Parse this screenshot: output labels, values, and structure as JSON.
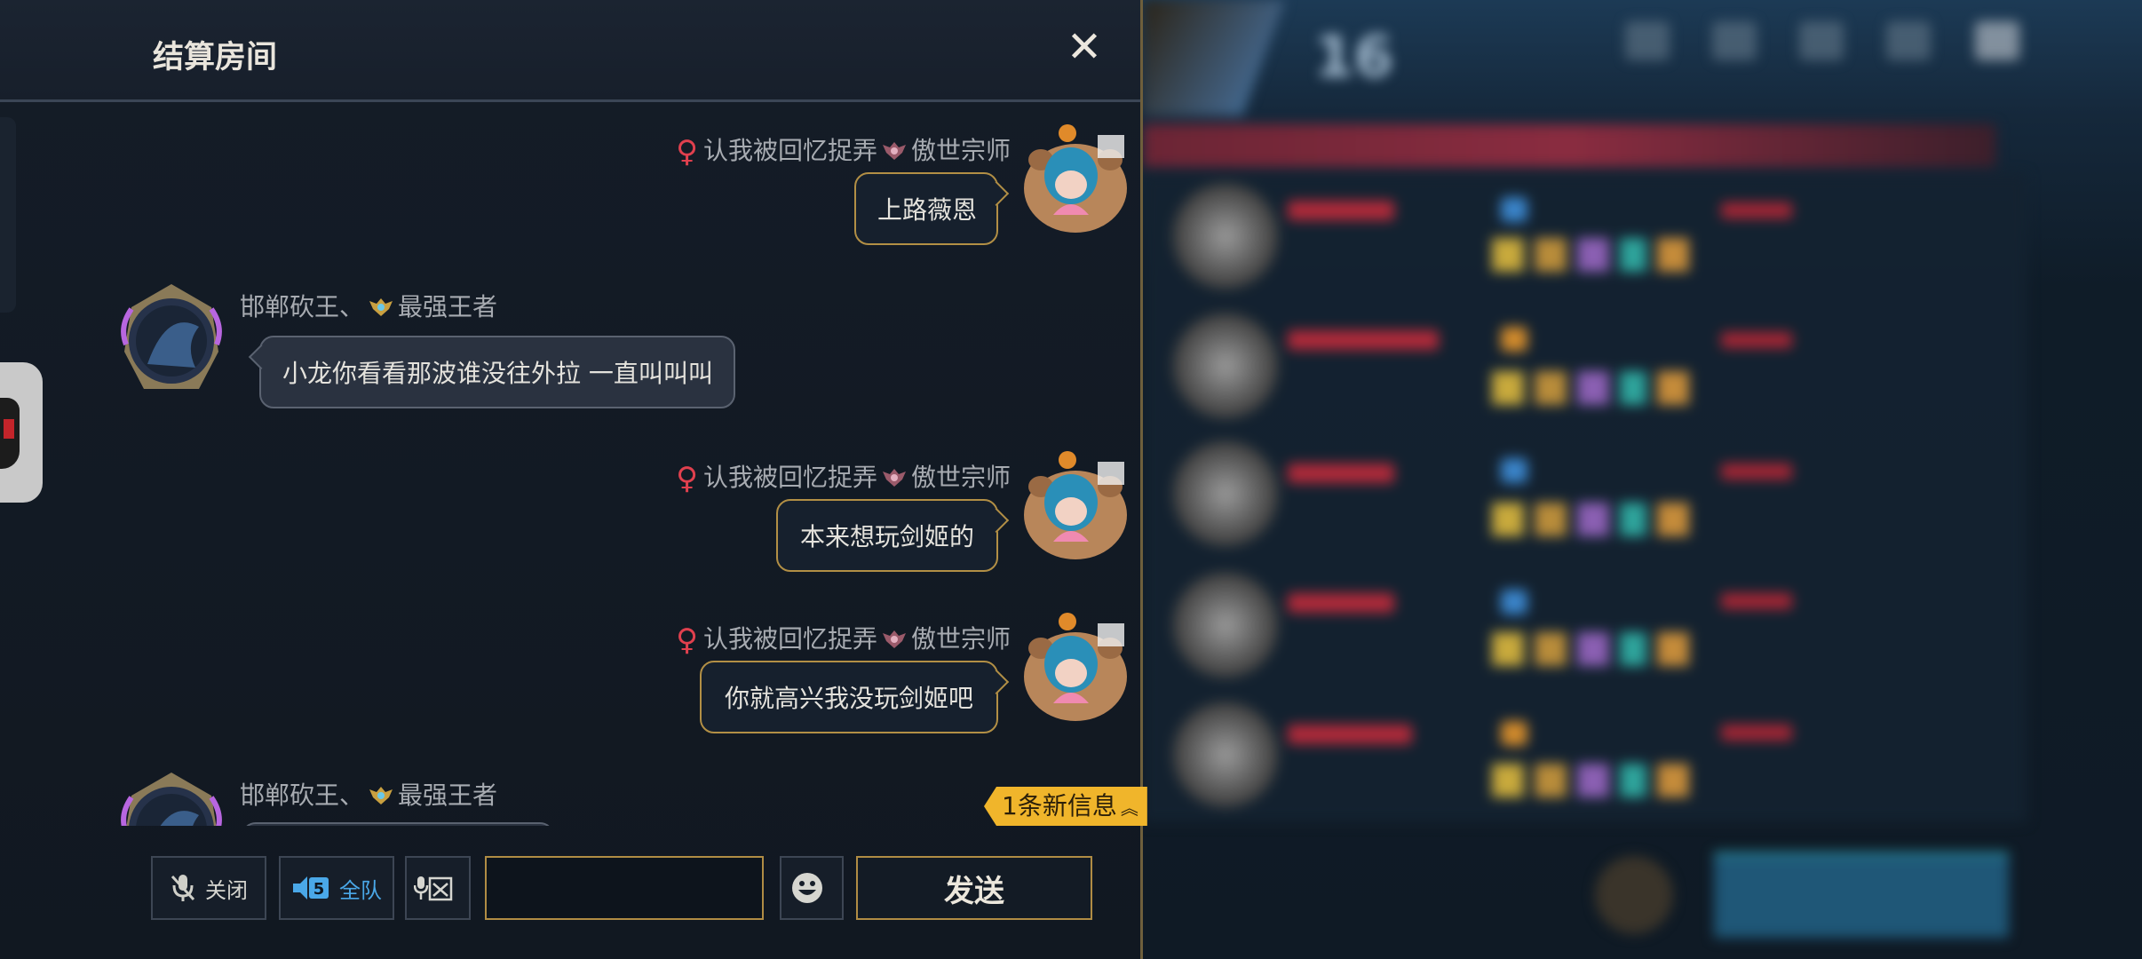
{
  "header": {
    "title": "结算房间",
    "close_icon": "close-icon"
  },
  "messages": [
    {
      "side": "right",
      "sender": "认我被回忆捉弄",
      "rank": "傲世宗师",
      "gender": "♀",
      "text": "上路薇恩"
    },
    {
      "side": "left",
      "sender": "邯郸砍王、",
      "rank": "最强王者",
      "text": "小龙你看看那波谁没往外拉 一直叫叫叫"
    },
    {
      "side": "right",
      "sender": "认我被回忆捉弄",
      "rank": "傲世宗师",
      "gender": "♀",
      "text": "本来想玩剑姬的"
    },
    {
      "side": "right",
      "sender": "认我被回忆捉弄",
      "rank": "傲世宗师",
      "gender": "♀",
      "text": "你就高兴我没玩剑姬吧"
    },
    {
      "side": "left",
      "sender": "邯郸砍王、",
      "rank": "最强王者",
      "text": ""
    }
  ],
  "new_message_pill": "1条新信息",
  "toolbar": {
    "mic_label": "关闭",
    "team_label": "全队",
    "team_count": "5",
    "send_label": "发送",
    "input_value": ""
  },
  "scoreboard": {
    "score": "16"
  },
  "colors": {
    "gold": "#b08c44",
    "accent_yellow": "#f0b52b",
    "female_icon": "#e0404e"
  }
}
